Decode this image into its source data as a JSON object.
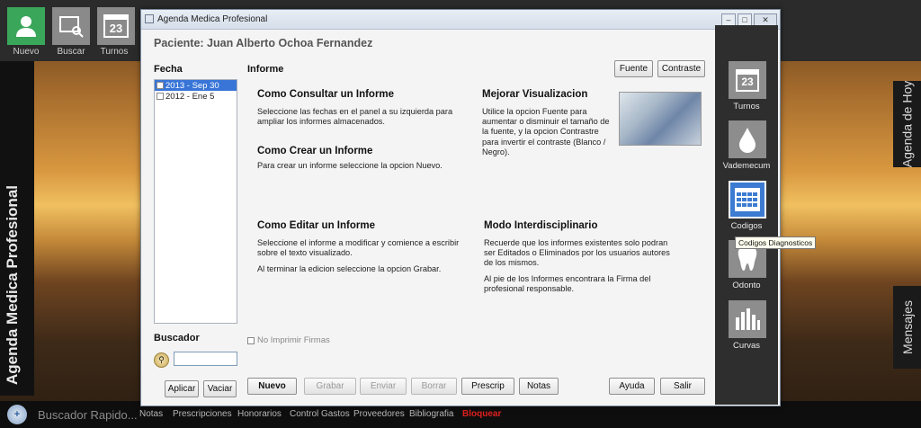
{
  "topbar": {
    "items": [
      {
        "label": "Nuevo",
        "icon": "person-icon"
      },
      {
        "label": "Buscar",
        "icon": "search-window-icon"
      },
      {
        "label": "Turnos",
        "icon": "calendar-icon",
        "day": "23"
      }
    ]
  },
  "app_vertical_title": "Agenda Medica Profesional",
  "right_tabs": {
    "agenda": "Agenda de Hoy",
    "messages": "Mensajes"
  },
  "quick_search": "Buscador Rapido...",
  "bottom_menu": [
    "Notas",
    "Prescripciones",
    "Honorarios",
    "Control Gastos",
    "Proveedores",
    "Bibliografia",
    "Bloquear"
  ],
  "window": {
    "title": "Agenda Medica Profesional",
    "patient": "Paciente: Juan Alberto Ochoa Fernandez",
    "fecha_label": "Fecha",
    "informe_label": "Informe",
    "dates": [
      {
        "label": "2013 - Sep 30",
        "selected": true
      },
      {
        "label": "2012 - Ene 5",
        "selected": false
      }
    ],
    "font_button": "Fuente",
    "contrast_button": "Contraste",
    "help": {
      "consultar_title": "Como Consultar un Informe",
      "consultar_text": "Seleccione las fechas en el panel a su izquierda para ampliar los informes almacenados.",
      "crear_title": "Como Crear un Informe",
      "crear_text": "Para crear un informe seleccione la opcion Nuevo.",
      "mejorar_title": "Mejorar Visualizacion",
      "mejorar_text": "Utilice la opcion Fuente para aumentar o disminuir el tamaño de la fuente, y la opcion Contrastre para invertir el contraste (Blanco / Negro).",
      "editar_title": "Como Editar un Informe",
      "editar_text1": "Seleccione el informe a modificar y comience a escribir sobre el texto visualizado.",
      "editar_text2": "Al terminar la edicion seleccione la opcion Grabar.",
      "modo_title": "Modo Interdisciplinario",
      "modo_text1": "Recuerde que los informes existentes solo podran ser Editados o Eliminados por los usuarios autores de los mismos.",
      "modo_text2": "Al pie de los Informes encontrara la Firma del profesional responsable."
    },
    "buscador_label": "Buscador",
    "search_value": "",
    "no_imprimir": "No Imprimir Firmas",
    "buttons": {
      "aplicar": "Aplicar",
      "vaciar": "Vaciar",
      "nuevo": "Nuevo",
      "grabar": "Grabar",
      "enviar": "Enviar",
      "borrar": "Borrar",
      "prescrip": "Prescrip",
      "notas": "Notas",
      "ayuda": "Ayuda",
      "salir": "Salir"
    }
  },
  "side_panel": [
    {
      "label": "Turnos",
      "icon": "calendar-icon",
      "day": "23"
    },
    {
      "label": "Vademecum",
      "icon": "drop-icon"
    },
    {
      "label": "Codigos",
      "icon": "grid-icon"
    },
    {
      "label": "Odonto",
      "icon": "tooth-icon"
    },
    {
      "label": "Curvas",
      "icon": "bar-chart-icon"
    }
  ],
  "tooltip": "Codigos Diagnosticos",
  "colors": {
    "accent_green": "#3aa65a",
    "bloquear_red": "#e02020",
    "selection_blue": "#3875d7"
  }
}
